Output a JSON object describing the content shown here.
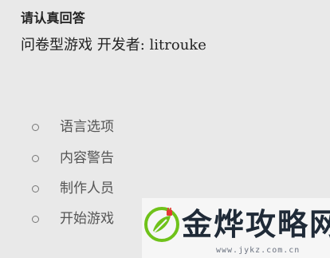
{
  "header": {
    "title": "请认真回答",
    "subtitle": "问卷型游戏 开发者: litrouke"
  },
  "menu": {
    "items": [
      {
        "label": "语言选项"
      },
      {
        "label": "内容警告"
      },
      {
        "label": "制作人员"
      },
      {
        "label": "开始游戏"
      }
    ]
  },
  "watermark": {
    "brand": "金烨攻略网",
    "url": "www.jykz.com.cn"
  },
  "colors": {
    "background": "#e9e9e9",
    "text": "#222222",
    "menu_text": "#555555",
    "logo_green": "#6fc21a",
    "logo_red": "#e53935"
  },
  "icons": {
    "menu_marker": "radio-circle",
    "watermark_logo": "leaf-plug-logo"
  }
}
